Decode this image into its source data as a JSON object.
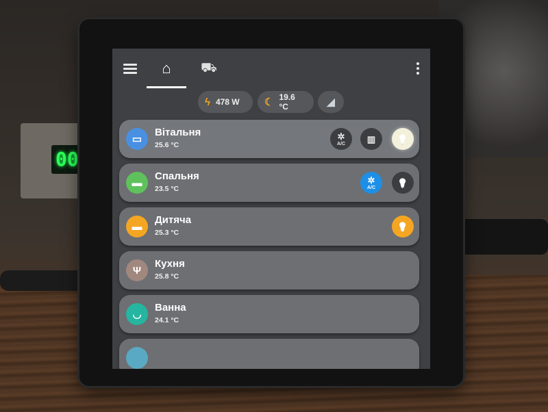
{
  "topbar": {
    "menu_icon": "menu-icon",
    "tabs": [
      {
        "icon": "home-icon",
        "glyph": "⌂",
        "active": true
      },
      {
        "icon": "robot-vacuum-icon",
        "glyph": "⛟",
        "active": false
      }
    ],
    "more_icon": "dots-vertical-icon"
  },
  "chips": {
    "power": {
      "icon": "lightning-icon",
      "glyph": "ϟ",
      "value": "478 W"
    },
    "temperature": {
      "icon": "weather-night-icon",
      "glyph": "☾",
      "value": "19.6 °C"
    },
    "device": {
      "icon": "robot-vacuum-icon",
      "glyph": "◢"
    }
  },
  "rooms": [
    {
      "name": "Вітальня",
      "temp": "25.6 °C",
      "icon": "sofa-icon",
      "glyph": "▭",
      "color": "#4a90e2",
      "buttons": [
        {
          "name": "ac-button",
          "icon": "fan-icon",
          "glyph": "✲",
          "label": "A/C",
          "state": "off"
        },
        {
          "name": "curtain-button",
          "icon": "curtains-icon",
          "glyph": "▥",
          "label": "",
          "state": "off"
        },
        {
          "name": "light-button",
          "icon": "lightbulb-icon",
          "glyph": "💡",
          "label": "",
          "state": "on"
        }
      ]
    },
    {
      "name": "Спальня",
      "temp": "23.5 °C",
      "icon": "bed-icon",
      "glyph": "▬",
      "color": "#5fc15b",
      "buttons": [
        {
          "name": "ac-button",
          "icon": "fan-icon",
          "glyph": "✲",
          "label": "A/C",
          "state": "on"
        },
        {
          "name": "light-button",
          "icon": "lightbulb-icon",
          "glyph": "💡",
          "label": "",
          "state": "off"
        }
      ]
    },
    {
      "name": "Дитяча",
      "temp": "25.3 °C",
      "icon": "bed-icon",
      "glyph": "▬",
      "color": "#f4a623",
      "buttons": [
        {
          "name": "light-button",
          "icon": "lightbulb-icon",
          "glyph": "💡",
          "label": "",
          "state": "on-orange"
        }
      ]
    },
    {
      "name": "Кухня",
      "temp": "25.8 °C",
      "icon": "silverware-icon",
      "glyph": "Ψ",
      "color": "#a1887f",
      "buttons": []
    },
    {
      "name": "Ванна",
      "temp": "24.1 °C",
      "icon": "bathtub-icon",
      "glyph": "◡",
      "color": "#26b5a0",
      "buttons": []
    }
  ],
  "colors": {
    "accent_blue": "#1e8fe6",
    "accent_orange": "#f4a623",
    "card_bg": "#6d6f73",
    "screen_bg": "#3f4043"
  }
}
